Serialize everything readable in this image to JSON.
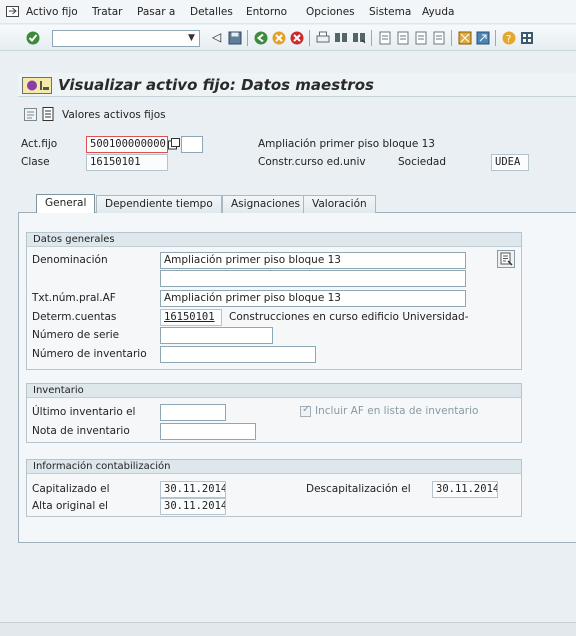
{
  "menubar": {
    "items": [
      {
        "label": "Activo fijo"
      },
      {
        "label": "Tratar"
      },
      {
        "label": "Pasar a"
      },
      {
        "label": "Detalles"
      },
      {
        "label": "Entorno"
      },
      {
        "label": "Opciones"
      },
      {
        "label": "Sistema"
      },
      {
        "label": "Ayuda"
      }
    ]
  },
  "toolbar": {
    "command_value": ""
  },
  "title": "Visualizar activo fijo: Datos maestros",
  "appbar": {
    "values_label": "Valores activos fijos"
  },
  "header": {
    "asset_label": "Act.fijo",
    "asset_number": "500100000000",
    "asset_sub": "",
    "asset_description": "Ampliación primer piso bloque 13",
    "class_label": "Clase",
    "class_value": "16150101",
    "class_description": "Constr.curso ed.univ",
    "company_label": "Sociedad",
    "company_value": "UDEA"
  },
  "tabs": [
    {
      "label": "General",
      "active": true
    },
    {
      "label": "Dependiente tiempo",
      "active": false
    },
    {
      "label": "Asignaciones",
      "active": false
    },
    {
      "label": "Valoración",
      "active": false
    }
  ],
  "general_data": {
    "title": "Datos generales",
    "description_label": "Denominación",
    "description_value": "Ampliación primer piso bloque 13",
    "description_value2": "",
    "main_text_label": "Txt.núm.pral.AF",
    "main_text_value": "Ampliación primer piso bloque 13",
    "account_det_label": "Determ.cuentas",
    "account_det_value": "16150101",
    "account_det_text": "Construcciones en curso edificio Universidad-",
    "serial_label": "Número de serie",
    "serial_value": "",
    "inventory_no_label": "Número de inventario",
    "inventory_no_value": ""
  },
  "inventory": {
    "title": "Inventario",
    "last_inventory_label": "Último inventario el",
    "last_inventory_value": "",
    "include_label": "Incluir AF en lista de inventario",
    "include_checked": true,
    "note_label": "Nota de inventario",
    "note_value": ""
  },
  "posting": {
    "title": "Información contabilización",
    "capitalized_label": "Capitalizado el",
    "capitalized_value": "30.11.2014",
    "deactivation_label": "Descapitalización el",
    "deactivation_value": "30.11.2014",
    "first_acq_label": "Alta original el",
    "first_acq_value": "30.11.2014"
  }
}
